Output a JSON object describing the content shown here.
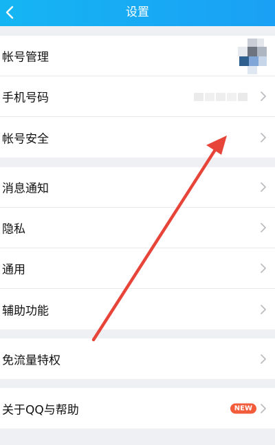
{
  "header": {
    "title": "设置",
    "back_icon": "chevron-left-icon"
  },
  "groups": [
    {
      "items": [
        {
          "label": "帐号管理",
          "chevron": false
        },
        {
          "label": "手机号码",
          "chevron": true
        },
        {
          "label": "帐号安全",
          "chevron": true
        }
      ]
    },
    {
      "items": [
        {
          "label": "消息通知",
          "chevron": true
        },
        {
          "label": "隐私",
          "chevron": true
        },
        {
          "label": "通用",
          "chevron": true
        },
        {
          "label": "辅助功能",
          "chevron": true
        }
      ]
    },
    {
      "items": [
        {
          "label": "免流量特权",
          "chevron": true
        }
      ]
    },
    {
      "items": [
        {
          "label": "关于QQ与帮助",
          "chevron": true,
          "badge": "NEW"
        }
      ]
    }
  ],
  "colors": {
    "header_bg": "#18acf3",
    "page_bg": "#eef0f4",
    "badge_bg": "#f25c3b",
    "annotation_arrow": "#e8453a"
  }
}
